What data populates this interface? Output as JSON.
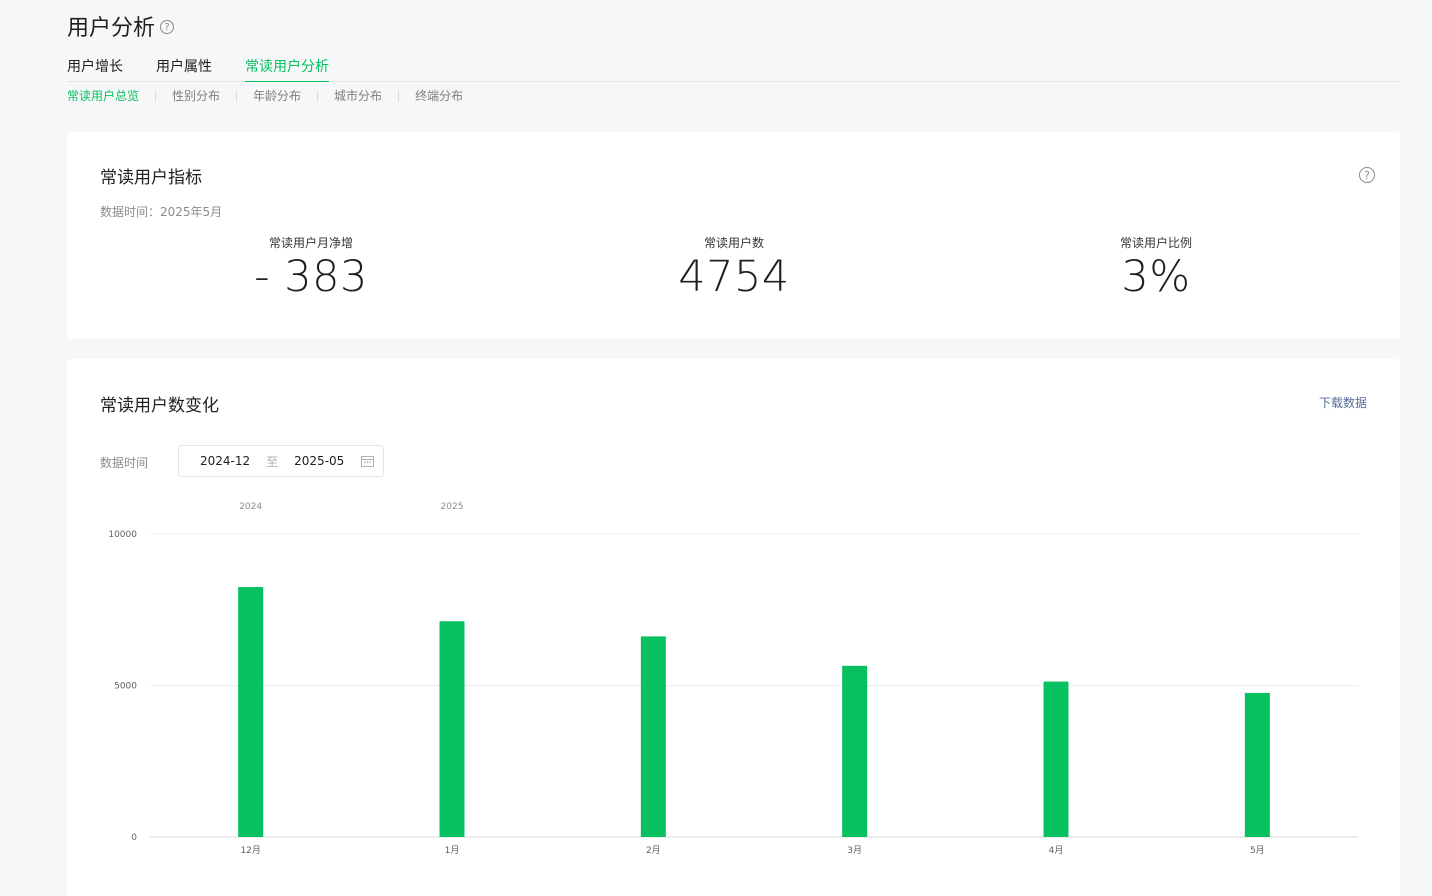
{
  "page": {
    "title": "用户分析",
    "help": "?"
  },
  "main_tabs": [
    {
      "label": "用户增长",
      "active": false
    },
    {
      "label": "用户属性",
      "active": false
    },
    {
      "label": "常读用户分析",
      "active": true
    }
  ],
  "sub_tabs": [
    {
      "label": "常读用户总览",
      "active": true
    },
    {
      "label": "性别分布",
      "active": false
    },
    {
      "label": "年龄分布",
      "active": false
    },
    {
      "label": "城市分布",
      "active": false
    },
    {
      "label": "终端分布",
      "active": false
    }
  ],
  "metrics_card": {
    "title": "常读用户指标",
    "data_time": "数据时间：2025年5月",
    "help": "?",
    "metrics": [
      {
        "label": "常读用户月净增",
        "value": "- 383"
      },
      {
        "label": "常读用户数",
        "value": "4754"
      },
      {
        "label": "常读用户比例",
        "value": "3%"
      }
    ]
  },
  "trend_card": {
    "title": "常读用户数变化",
    "download": "下载数据",
    "date_label": "数据时间",
    "date_start": "2024-12",
    "date_to": "至",
    "date_end": "2025-05"
  },
  "colors": {
    "accent": "#07c160",
    "link": "#576b95"
  },
  "chart_data": {
    "type": "bar",
    "categories": [
      "12月",
      "1月",
      "2月",
      "3月",
      "4月",
      "5月"
    ],
    "year_labels": [
      {
        "label": "2024",
        "category": "12月"
      },
      {
        "label": "2025",
        "category": "1月"
      }
    ],
    "series": [
      {
        "values": [
          8250,
          7120,
          6620,
          5650,
          5130,
          4754
        ]
      }
    ],
    "ylim": [
      0,
      10000
    ],
    "yticks": [
      0,
      5000,
      10000
    ],
    "grid": true,
    "color": "#07c160"
  }
}
